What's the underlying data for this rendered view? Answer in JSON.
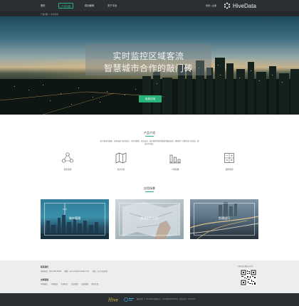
{
  "nav": {
    "items": [
      {
        "label": "首页",
        "active": false
      },
      {
        "label": "产品功能",
        "active": true
      },
      {
        "label": "成功案例",
        "active": false
      },
      {
        "label": "关于平台",
        "active": false
      }
    ],
    "login": "登录 | 注册",
    "brand": "HiveData"
  },
  "breadcrumb": "产品功能 > 实时客流",
  "hero": {
    "line1": "实时监控区域客流",
    "line2": "智慧城市合作的敲门砖",
    "button": "免费试用"
  },
  "intro": {
    "title": "产品介绍",
    "text": "基于移动大数据，对客流进行实时监控，为区域管理、商业运营、城市规划等提供精准的数据支撑，帮助用户了解区域人流动态，做出科学决策。",
    "features": [
      {
        "label": "客流监测",
        "icon": "people-network-icon"
      },
      {
        "label": "热力分析",
        "icon": "map-icon"
      },
      {
        "label": "人群画像",
        "icon": "bar-chart-icon"
      },
      {
        "label": "趋势预测",
        "icon": "calculator-icon"
      }
    ]
  },
  "cases": {
    "title": "应用场景",
    "items": [
      {
        "label": "城市管理"
      },
      {
        "label": "旅游出行分析"
      },
      {
        "label": "交通出行"
      }
    ]
  },
  "footer": {
    "contact_title": "联系我们",
    "contact_line": [
      "热线电话：400-000-0000",
      "邮箱：service@hivedata.com",
      "地址：北京市海淀区"
    ],
    "links_title": "友情链接",
    "links": [
      "中国移动",
      "中国联通",
      "中国电信",
      "百度地图",
      "高德地图",
      "腾讯位置"
    ],
    "qr_caption": "扫码关注微信公众号",
    "copyright": "版权所有 © HiveData 数据平台 · 京ICP备00000000号 · 技术支持：HiveData"
  }
}
